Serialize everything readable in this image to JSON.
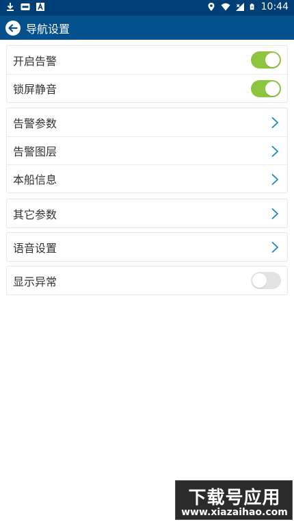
{
  "status_bar": {
    "time": "10:44",
    "left_icons": [
      "download-icon",
      "hmd-icon",
      "a-icon"
    ],
    "right_icons": [
      "location-icon",
      "wifi-icon",
      "signal-icon",
      "battery-icon"
    ]
  },
  "header": {
    "title": "导航设置"
  },
  "groups": [
    {
      "items": [
        {
          "label": "开启告警",
          "type": "toggle",
          "on": true
        },
        {
          "label": "锁屏静音",
          "type": "toggle",
          "on": true
        }
      ]
    },
    {
      "items": [
        {
          "label": "告警参数",
          "type": "nav"
        },
        {
          "label": "告警图层",
          "type": "nav"
        },
        {
          "label": "本船信息",
          "type": "nav"
        }
      ]
    },
    {
      "items": [
        {
          "label": "其它参数",
          "type": "nav"
        }
      ]
    },
    {
      "items": [
        {
          "label": "语音设置",
          "type": "nav"
        }
      ]
    },
    {
      "items": [
        {
          "label": "显示异常",
          "type": "toggle",
          "on": false
        }
      ]
    }
  ],
  "watermark": {
    "title": "下载号应用",
    "url": "www.xiazaihao.com"
  },
  "colors": {
    "status_bar": "#003f75",
    "title_bar": "#04508c",
    "toggle_on": "#8dc53f",
    "toggle_off": "#e3e3e3",
    "chevron": "#1a86c8"
  }
}
